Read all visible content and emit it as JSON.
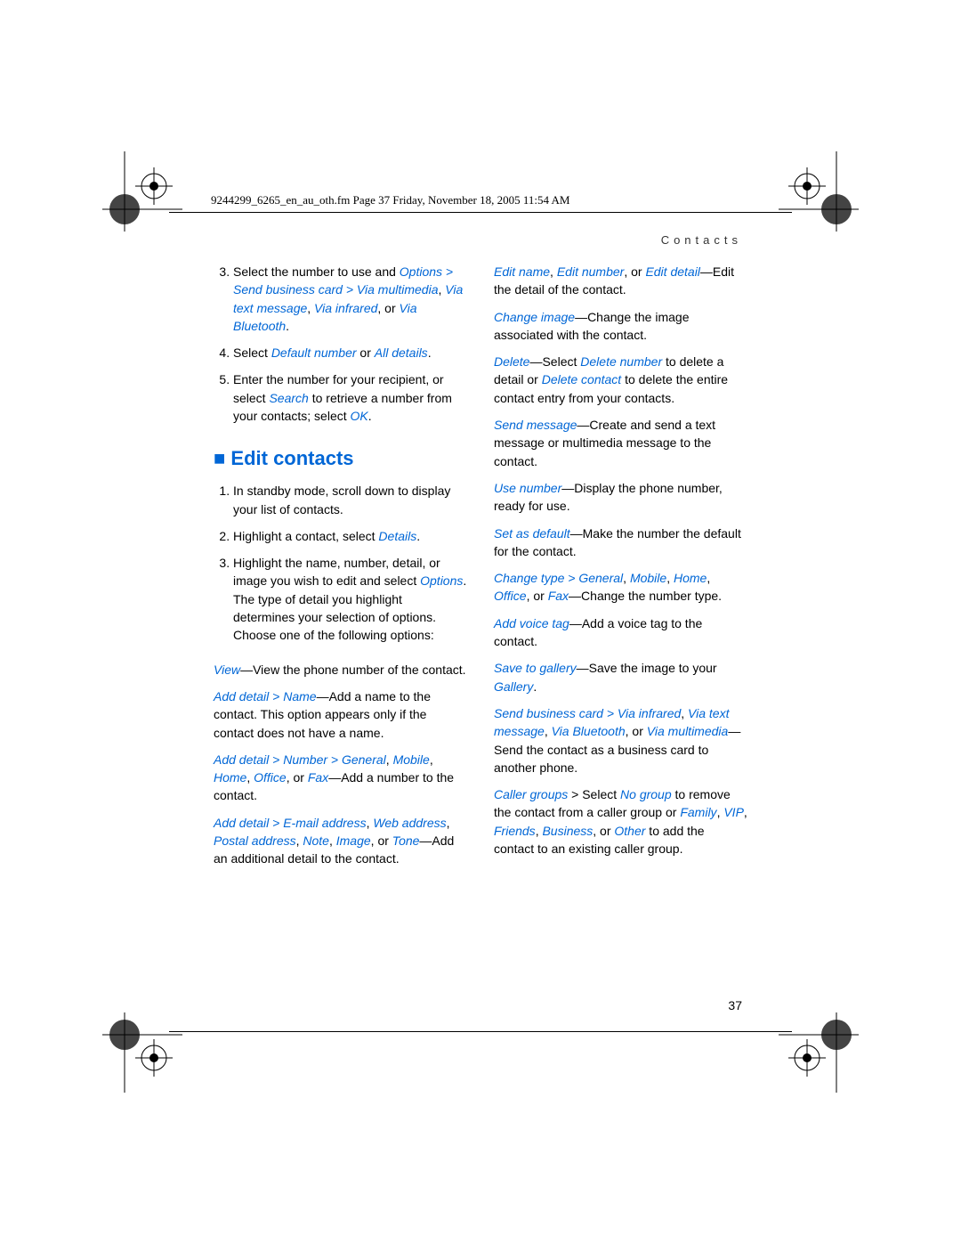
{
  "header": "9244299_6265_en_au_oth.fm  Page 37  Friday, November 18, 2005  11:54 AM",
  "section": "Contacts",
  "page_number": "37",
  "heading_edit": "Edit contacts",
  "left": {
    "step3_a": "Select the number to use and ",
    "step3_b": "Options > Send business card > Via multimedia",
    "step3_c": ", ",
    "step3_d": "Via text message",
    "step3_e": ", ",
    "step3_f": "Via infrared",
    "step3_g": ", or ",
    "step3_h": "Via Bluetooth",
    "step3_i": ".",
    "step4_a": "Select ",
    "step4_b": "Default number",
    "step4_c": " or ",
    "step4_d": "All details",
    "step4_e": ".",
    "step5_a": "Enter the number for your recipient, or select ",
    "step5_b": "Search",
    "step5_c": " to retrieve a number from your contacts; select ",
    "step5_d": "OK",
    "step5_e": ".",
    "e1": "In standby mode, scroll down to display your list of contacts.",
    "e2_a": "Highlight a contact, select ",
    "e2_b": "Details",
    "e2_c": ".",
    "e3_a": "Highlight the name, number, detail, or image you wish to edit and select ",
    "e3_b": "Options",
    "e3_c": ". The type of detail you highlight determines your selection of options. Choose one of the following options:",
    "view_a": "View",
    "view_b": "—View the phone number of the contact.",
    "addname_a": "Add detail > Name",
    "addname_b": "—Add a name to the contact. This option appears only if the contact does not have a name.",
    "addnum_a": "Add detail > Number > General",
    "addnum_b": ", ",
    "addnum_c": "Mobile",
    "addnum_d": ", ",
    "addnum_e": "Home",
    "addnum_f": ", ",
    "addnum_g": "Office",
    "addnum_h": ", or ",
    "addnum_i": "Fax",
    "addnum_j": "—Add a number to the contact.",
    "adddet_a": "Add detail > E-mail address",
    "adddet_b": ", ",
    "adddet_c": "Web address",
    "adddet_d": ", ",
    "adddet_e": "Postal address",
    "adddet_f": ", ",
    "adddet_g": "Note",
    "adddet_h": ", ",
    "adddet_i": "Image",
    "adddet_j": ", or ",
    "adddet_k": "Tone",
    "adddet_l": "—Add an additional detail to the contact."
  },
  "right": {
    "editname_a": "Edit name",
    "editname_b": ", ",
    "editname_c": "Edit number",
    "editname_d": ", or ",
    "editname_e": "Edit detail",
    "editname_f": "—Edit the detail of the contact.",
    "chimg_a": "Change image",
    "chimg_b": "—Change the image associated with the contact.",
    "del_a": "Delete",
    "del_b": "—Select ",
    "del_c": "Delete number",
    "del_d": " to delete a detail or ",
    "del_e": "Delete contact",
    "del_f": " to delete the entire contact entry from your contacts.",
    "send_a": "Send message",
    "send_b": "—Create and send a text message or multimedia message to the contact.",
    "usenum_a": "Use number",
    "usenum_b": "—Display the phone number, ready for use.",
    "setdef_a": "Set as default",
    "setdef_b": "—Make the number the default for the contact.",
    "chtype_a": "Change type > General",
    "chtype_b": ", ",
    "chtype_c": "Mobile",
    "chtype_d": ", ",
    "chtype_e": "Home",
    "chtype_f": ", ",
    "chtype_g": "Office",
    "chtype_h": ", or ",
    "chtype_i": "Fax",
    "chtype_j": "—Change the number type.",
    "voice_a": "Add voice tag",
    "voice_b": "—Add a voice tag to the contact.",
    "save_a": "Save to gallery",
    "save_b": "—Save the image to your ",
    "save_c": "Gallery",
    "save_d": ".",
    "sbc_a": "Send business card > Via infrared",
    "sbc_b": ", ",
    "sbc_c": "Via text message",
    "sbc_d": ", ",
    "sbc_e": "Via Bluetooth",
    "sbc_f": ", or ",
    "sbc_g": "Via multimedia",
    "sbc_h": "—Send the contact as a business card to another phone.",
    "cg_a": "Caller groups",
    "cg_b": " > Select ",
    "cg_c": "No group",
    "cg_d": " to remove the contact from a caller group or ",
    "cg_e": "Family",
    "cg_f": ", ",
    "cg_g": "VIP",
    "cg_h": ", ",
    "cg_i": "Friends",
    "cg_j": ", ",
    "cg_k": "Business",
    "cg_l": ", or ",
    "cg_m": "Other",
    "cg_n": " to add the contact to an existing caller group."
  }
}
